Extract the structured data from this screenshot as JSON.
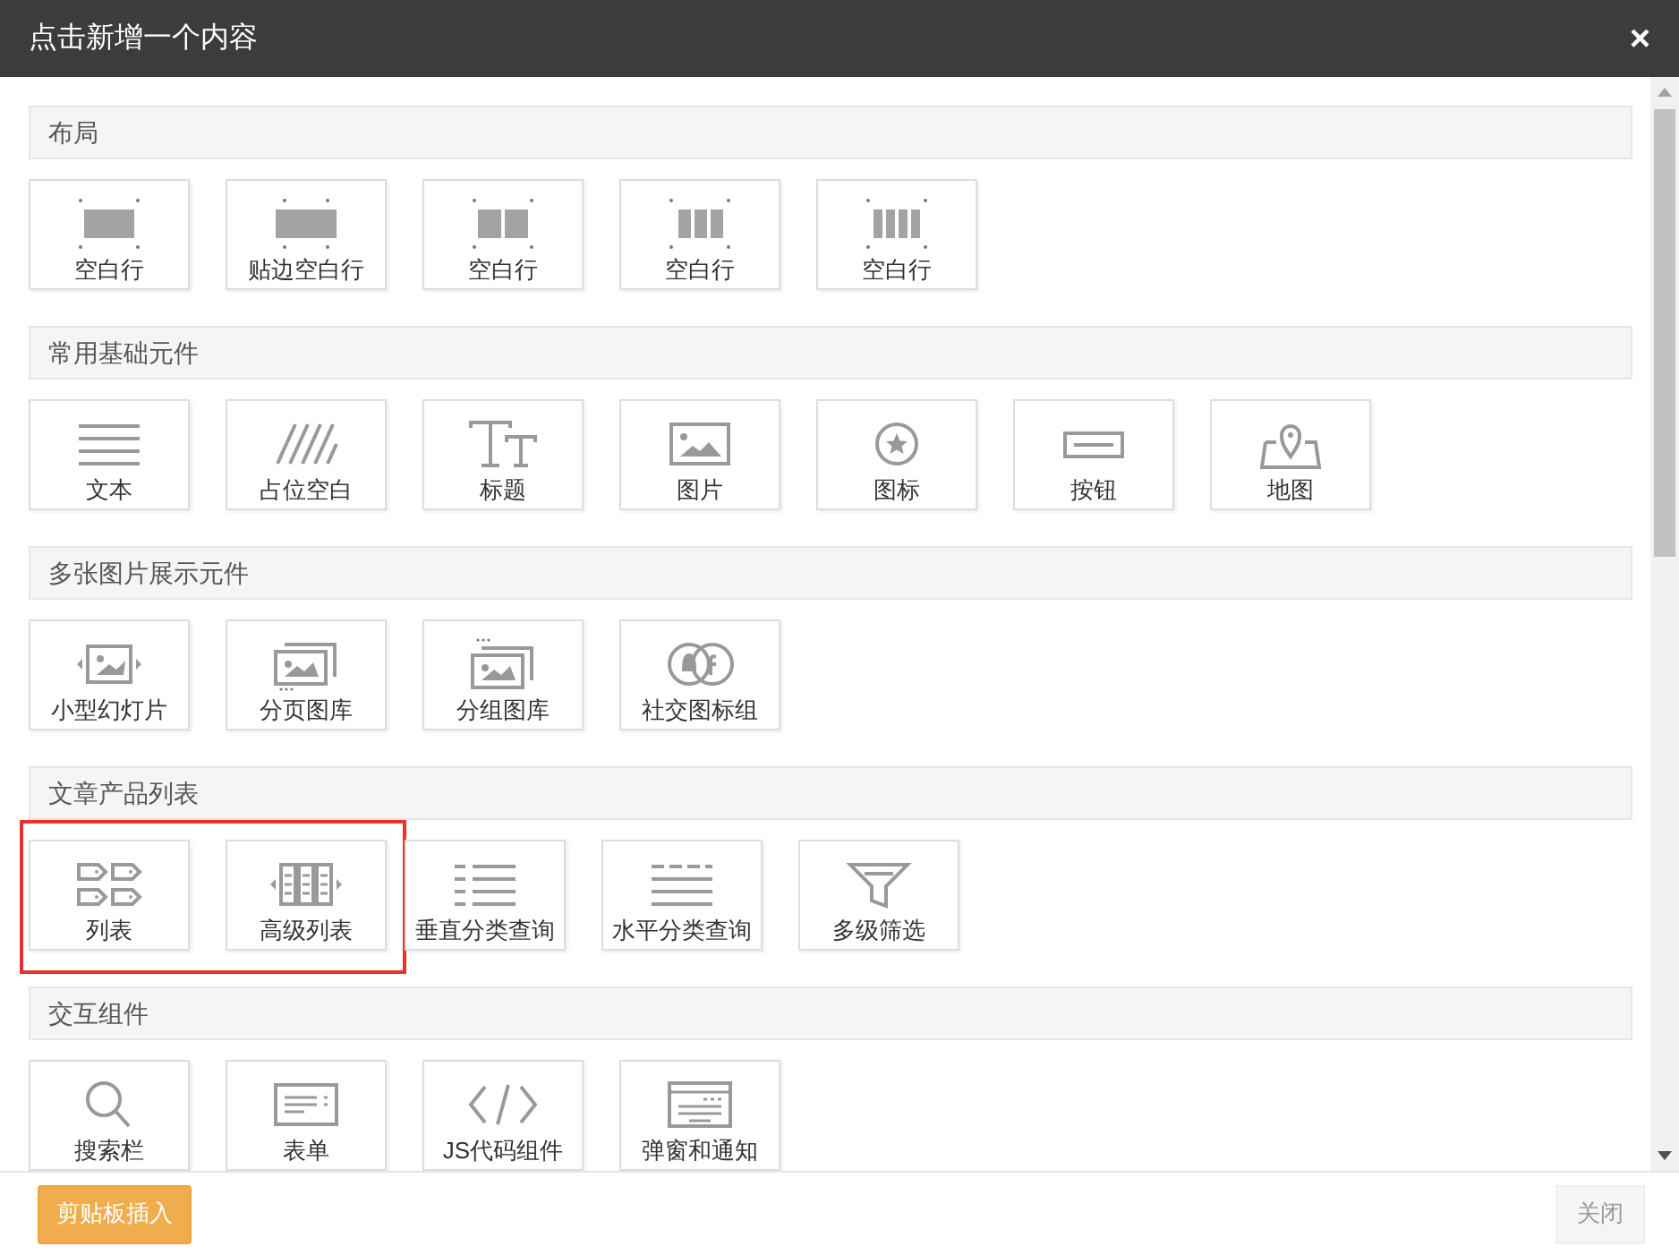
{
  "dialog": {
    "title": "点击新增一个内容",
    "close_icon": "×"
  },
  "sections": [
    {
      "title": "布局",
      "items": [
        {
          "label": "空白行",
          "highlighted": false
        },
        {
          "label": "贴边空白行",
          "highlighted": false
        },
        {
          "label": "空白行",
          "highlighted": false
        },
        {
          "label": "空白行",
          "highlighted": false
        },
        {
          "label": "空白行",
          "highlighted": false
        }
      ]
    },
    {
      "title": "常用基础元件",
      "items": [
        {
          "label": "文本",
          "highlighted": false
        },
        {
          "label": "占位空白",
          "highlighted": false
        },
        {
          "label": "标题",
          "highlighted": false
        },
        {
          "label": "图片",
          "highlighted": false
        },
        {
          "label": "图标",
          "highlighted": false
        },
        {
          "label": "按钮",
          "highlighted": false
        },
        {
          "label": "地图",
          "highlighted": false
        }
      ]
    },
    {
      "title": "多张图片展示元件",
      "items": [
        {
          "label": "小型幻灯片",
          "highlighted": false
        },
        {
          "label": "分页图库",
          "highlighted": false
        },
        {
          "label": "分组图库",
          "highlighted": false
        },
        {
          "label": "社交图标组",
          "highlighted": false
        }
      ]
    },
    {
      "title": "文章产品列表",
      "items": [
        {
          "label": "列表",
          "highlighted": true
        },
        {
          "label": "高级列表",
          "highlighted": true
        },
        {
          "label": "垂直分类查询",
          "highlighted": false
        },
        {
          "label": "水平分类查询",
          "highlighted": false
        },
        {
          "label": "多级筛选",
          "highlighted": false
        }
      ]
    },
    {
      "title": "交互组件",
      "items": [
        {
          "label": "搜索栏",
          "highlighted": false
        },
        {
          "label": "表单",
          "highlighted": false
        },
        {
          "label": "JS代码组件",
          "highlighted": false
        },
        {
          "label": "弹窗和通知",
          "highlighted": false
        }
      ]
    }
  ],
  "footer": {
    "paste_button": "剪贴板插入",
    "close_button": "关闭"
  }
}
